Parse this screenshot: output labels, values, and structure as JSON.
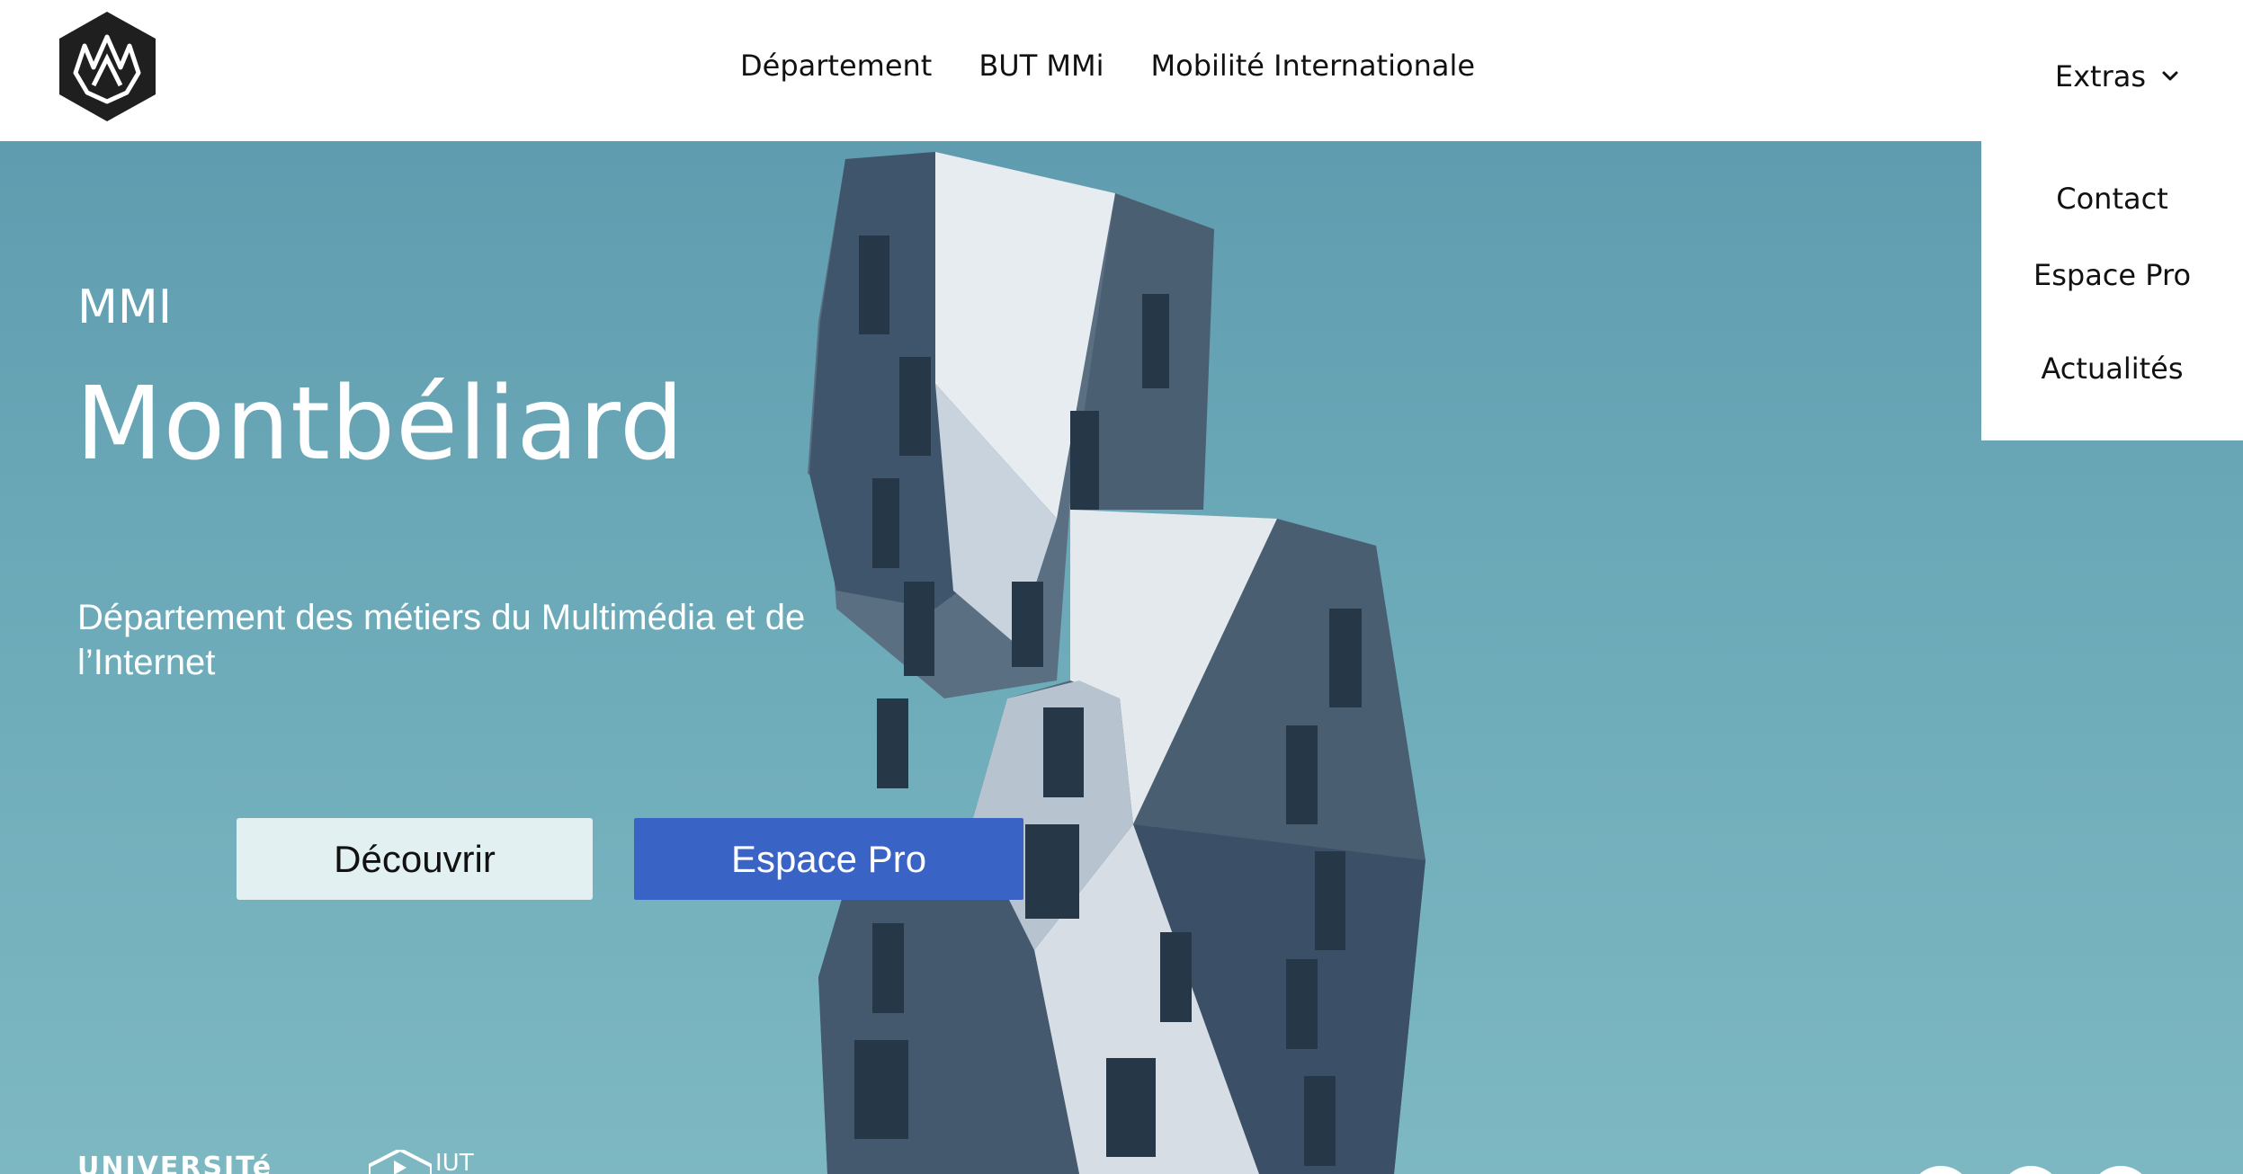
{
  "header": {
    "nav": [
      "Département",
      "BUT MMi",
      "Mobilité Internationale"
    ],
    "extras_label": "Extras"
  },
  "dropdown": {
    "items": [
      "Contact",
      "Espace Pro",
      "Actualités"
    ]
  },
  "hero": {
    "eyebrow": "MMI",
    "title": "Montbéliard",
    "subtitle": "Département des métiers du Multimédia et de l’Internet",
    "buttons": {
      "discover": "Découvrir",
      "pro": "Espace  Pro"
    }
  },
  "footer": {
    "university_text": "UNIVERSITé",
    "iut_text": "IUT"
  },
  "colors": {
    "primary_button": "#3a63c6",
    "secondary_button": "#e3f0f2",
    "sky": "#6fa8b6"
  }
}
